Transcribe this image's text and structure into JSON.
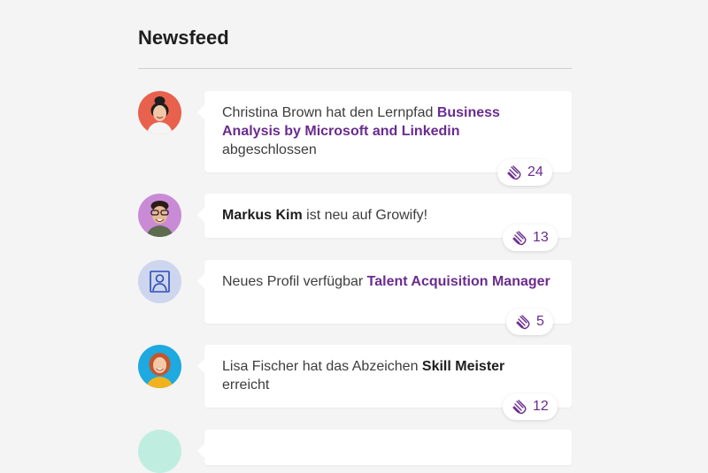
{
  "title": "Newsfeed",
  "items": [
    {
      "pre": "Christina Brown hat den Lernpfad ",
      "highlight": "Business Analysis by Microsoft and Linkedin",
      "post": " abgeschlossen",
      "claps": "24",
      "avatar": "woman-portrait-red"
    },
    {
      "pre": "",
      "highlight": "Markus Kim",
      "post": " ist neu auf Growify!",
      "claps": "13",
      "avatar": "man-portrait-purple"
    },
    {
      "pre": "Neues Profil verfügbar ",
      "highlight": "Talent Acquisition Manager",
      "post": "",
      "claps": "5",
      "avatar": "profile-icon"
    },
    {
      "pre": "Lisa Fischer hat das Abzeichen ",
      "highlight": "Skill Meister",
      "post": " erreicht",
      "claps": "12",
      "avatar": "woman-portrait-blue"
    }
  ],
  "colors": {
    "accent": "#6a2c8e",
    "avatar_red": "#e8614d",
    "avatar_purple": "#c98bd6",
    "avatar_profile": "#cdd6ee",
    "avatar_blue": "#1ea9e0",
    "avatar_mint": "#bfeee0"
  }
}
